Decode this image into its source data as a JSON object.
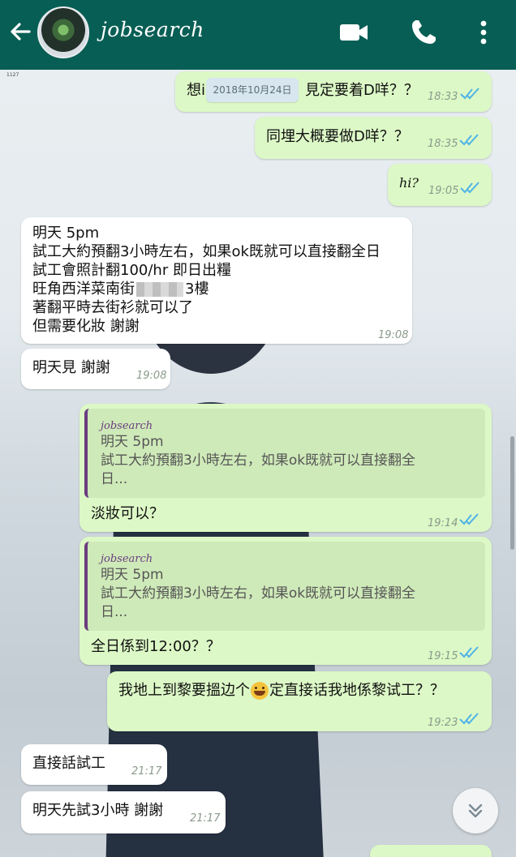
{
  "header": {
    "contact_name": "jobsearch",
    "icons": [
      "back-arrow-icon",
      "video-call-icon",
      "phone-call-icon",
      "more-options-icon"
    ],
    "bg_color": "#075e54"
  },
  "date_chip": "2018年10月24日",
  "corner_mark": "1127",
  "messages": [
    {
      "dir": "out",
      "lines": [
        "想i",
        "見定要着D咩？？"
      ],
      "time": "18:33",
      "read": true
    },
    {
      "dir": "out",
      "lines": [
        "同埋大概要做D咩？？"
      ],
      "time": "18:35",
      "read": true
    },
    {
      "dir": "out",
      "lines": [
        "hi?"
      ],
      "time": "19:05",
      "read": true
    },
    {
      "dir": "in",
      "lines": [
        "明天 5pm",
        "試工大約預翻3小時左右，如果ok既就可以直接翻全日",
        "試工會照計翻100/hr 即日出糧",
        "旺角西洋菜南街",
        "3樓",
        "著翻平時去街衫就可以了",
        "但需要化妝 謝謝"
      ],
      "time": "19:08"
    },
    {
      "dir": "in",
      "lines": [
        "明天見 謝謝"
      ],
      "time": "19:08"
    },
    {
      "dir": "out",
      "quote": {
        "name": "jobsearch",
        "lines": [
          "明天 5pm",
          "試工大約預翻3小時左右，如果ok既就可以直接翻全",
          "日..."
        ]
      },
      "lines": [
        "淡妝可以？"
      ],
      "time": "19:14",
      "read": true
    },
    {
      "dir": "out",
      "quote": {
        "name": "jobsearch",
        "lines": [
          "明天 5pm",
          "試工大約預翻3小時左右，如果ok既就可以直接翻全",
          "日..."
        ]
      },
      "lines": [
        "全日係到12:00？？"
      ],
      "time": "19:15",
      "read": true
    },
    {
      "dir": "out",
      "lines": [
        "我地上到黎要搵边个",
        "定直接话我地係黎试工？？"
      ],
      "time": "19:23",
      "read": true
    },
    {
      "dir": "in",
      "lines": [
        "直接話試工"
      ],
      "time": "21:17"
    },
    {
      "dir": "in",
      "lines": [
        "明天先試3小時 謝謝"
      ],
      "time": "21:17"
    }
  ],
  "colors": {
    "outgoing": "#dcf8c6",
    "incoming": "#ffffff",
    "read_ticks": "#4fb3e8"
  }
}
